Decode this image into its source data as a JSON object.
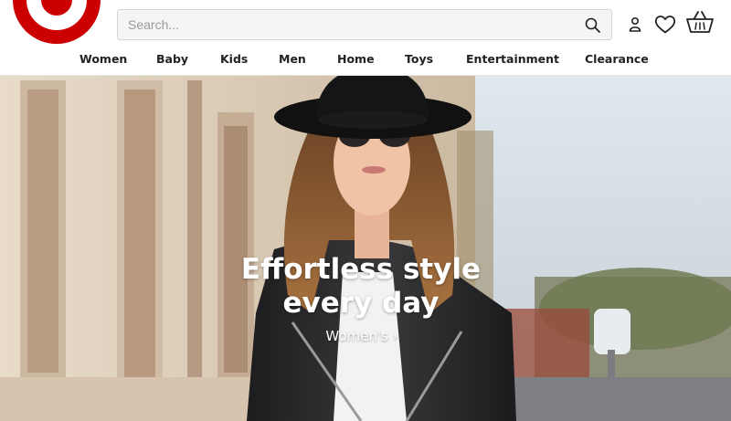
{
  "brand": {
    "accent_color": "#cc0000",
    "logo_icon": "target-bullseye-logo"
  },
  "search": {
    "placeholder": "Search...",
    "value": ""
  },
  "header_icons": [
    "search-icon",
    "account-icon",
    "wishlist-heart-icon",
    "cart-basket-icon"
  ],
  "nav": {
    "items": [
      {
        "label": "Women"
      },
      {
        "label": "Baby"
      },
      {
        "label": "Kids"
      },
      {
        "label": "Men"
      },
      {
        "label": "Home"
      },
      {
        "label": "Toys"
      },
      {
        "label": "Entertainment"
      },
      {
        "label": "Clearance"
      }
    ]
  },
  "hero": {
    "headline_line1": "Effortless style",
    "headline_line2": "every day",
    "cta_label": "Women's",
    "cta_arrow": "›"
  }
}
